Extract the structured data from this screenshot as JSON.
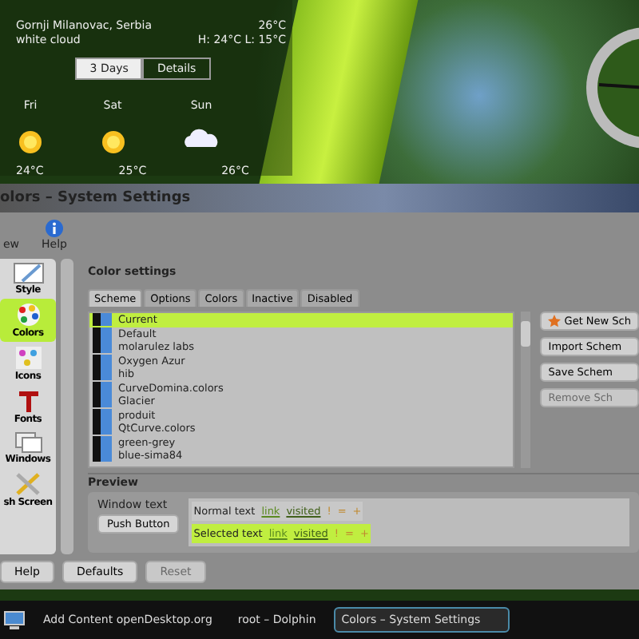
{
  "weather": {
    "location": "Gornji Milanovac, Serbia",
    "condition": "white cloud",
    "temperature": "26°C",
    "high_low": "H: 24°C L: 15°C",
    "tabs": [
      {
        "label": "3 Days",
        "selected": true
      },
      {
        "label": "Details",
        "selected": false
      }
    ],
    "days": [
      {
        "day": "Fri",
        "kind": "sun",
        "temp": "24°C"
      },
      {
        "day": "Sat",
        "kind": "sun",
        "temp": "25°C"
      },
      {
        "day": "Sun",
        "kind": "cloud",
        "temp": "26°C"
      }
    ]
  },
  "window": {
    "title": "olors – System Settings",
    "toolbar": [
      {
        "label": "ew",
        "kind": "blank"
      },
      {
        "label": "Help",
        "kind": "help"
      }
    ]
  },
  "sidebar": {
    "items": [
      {
        "label": "Style",
        "kind": "style",
        "selected": false
      },
      {
        "label": "Colors",
        "kind": "colors",
        "selected": true
      },
      {
        "label": "Icons",
        "kind": "icons",
        "selected": false
      },
      {
        "label": "Fonts",
        "kind": "fonts",
        "selected": false
      },
      {
        "label": "Windows",
        "kind": "windows",
        "selected": false
      },
      {
        "label": "sh Screen",
        "kind": "tools",
        "selected": false
      }
    ]
  },
  "page_title": "Color settings",
  "tabs": [
    {
      "label": "Scheme",
      "selected": true
    },
    {
      "label": "Options",
      "selected": false
    },
    {
      "label": "Colors",
      "selected": false
    },
    {
      "label": "Inactive",
      "selected": false
    },
    {
      "label": "Disabled",
      "selected": false
    }
  ],
  "schemes": [
    {
      "name": "Current",
      "selected": true
    },
    {
      "name": "Default",
      "selected": false
    },
    {
      "name": "molarulez labs",
      "selected": false
    },
    {
      "name": "Oxygen Azur",
      "selected": false
    },
    {
      "name": "hib",
      "selected": false
    },
    {
      "name": "CurveDomina.colors",
      "selected": false
    },
    {
      "name": "Glacier",
      "selected": false
    },
    {
      "name": "produit",
      "selected": false
    },
    {
      "name": "QtCurve.colors",
      "selected": false
    },
    {
      "name": "green-grey",
      "selected": false
    },
    {
      "name": "blue-sima84",
      "selected": false
    }
  ],
  "scheme_buttons": [
    {
      "label": "Get New Sch",
      "kind": "star",
      "disabled": false
    },
    {
      "label": "Import Schem",
      "kind": "plain",
      "disabled": false
    },
    {
      "label": "Save Schem",
      "kind": "plain",
      "disabled": false
    },
    {
      "label": "Remove Sch",
      "kind": "plain",
      "disabled": true
    }
  ],
  "preview": {
    "title": "Preview",
    "window_text": "Window text",
    "push_button": "Push Button",
    "rows": [
      {
        "label": "Normal text",
        "link": "link",
        "visited": "visited",
        "marks": [
          "!",
          "=",
          "+"
        ],
        "selected": false
      },
      {
        "label": "Selected text",
        "link": "link",
        "visited": "visited",
        "marks": [
          "!",
          "=",
          "+"
        ],
        "selected": true
      }
    ]
  },
  "footer_buttons": [
    {
      "label": "Help",
      "disabled": false
    },
    {
      "label": "Defaults",
      "disabled": false
    },
    {
      "label": "Reset",
      "disabled": true
    }
  ],
  "taskbar": [
    {
      "label": "Add Content openDesktop.org",
      "active": false
    },
    {
      "label": "root – Dolphin",
      "active": false
    },
    {
      "label": "Colors – System Settings",
      "active": true
    }
  ]
}
